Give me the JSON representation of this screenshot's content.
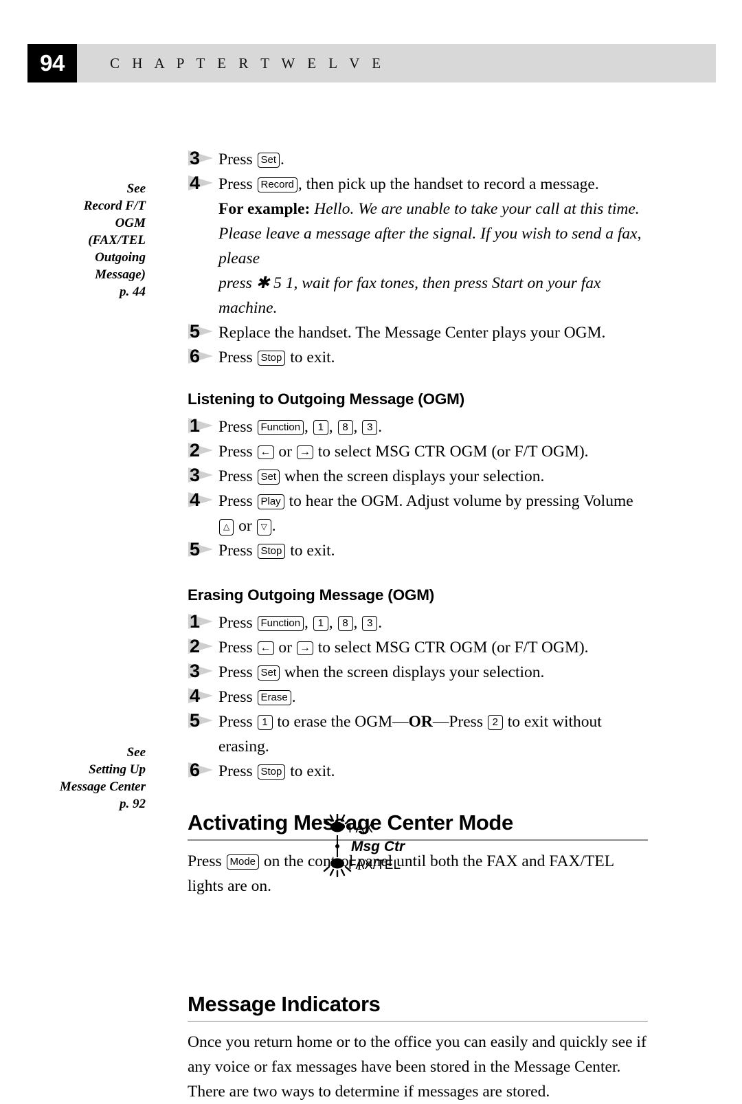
{
  "header": {
    "page_number": "94",
    "chapter_label": "C H A P T E R   T W E L V E"
  },
  "margin_notes": [
    {
      "name": "margin-note-record-ft-ogm",
      "lines": [
        "See",
        "Record F/T",
        "OGM",
        "(FAX/TEL",
        "Outgoing",
        "Message)",
        "p. 44"
      ]
    },
    {
      "name": "margin-note-setting-up-message-center",
      "lines": [
        "See",
        "Setting Up",
        "Message Center",
        "p. 92"
      ]
    }
  ],
  "steps_record": [
    {
      "num": "3",
      "parts": [
        {
          "t": "text",
          "v": "Press "
        },
        {
          "t": "key",
          "v": "Set"
        },
        {
          "t": "text",
          "v": "."
        }
      ]
    },
    {
      "num": "4",
      "parts": [
        {
          "t": "text",
          "v": "Press "
        },
        {
          "t": "key",
          "v": "Record"
        },
        {
          "t": "text",
          "v": ", then pick up the handset to record a message."
        }
      ]
    }
  ],
  "example": {
    "lead": "For example:",
    "lines": [
      " Hello. We are unable to take your call at this time.",
      "Please leave a message after the signal. If you wish to send a fax,",
      "please",
      "press ✱ 5 1, wait for fax tones, then press Start on your fax machine."
    ]
  },
  "steps_record_tail": [
    {
      "num": "5",
      "parts": [
        {
          "t": "text",
          "v": "Replace the handset. The Message Center plays your OGM."
        }
      ]
    },
    {
      "num": "6",
      "parts": [
        {
          "t": "text",
          "v": "Press "
        },
        {
          "t": "key",
          "v": "Stop"
        },
        {
          "t": "text",
          "v": " to exit."
        }
      ]
    }
  ],
  "section_listening": {
    "heading": "Listening to Outgoing Message (OGM)",
    "steps": [
      {
        "num": "1",
        "parts": [
          {
            "t": "text",
            "v": "Press "
          },
          {
            "t": "key",
            "v": "Function"
          },
          {
            "t": "text",
            "v": ", "
          },
          {
            "t": "numkey",
            "v": "1"
          },
          {
            "t": "text",
            "v": ", "
          },
          {
            "t": "numkey",
            "v": "8"
          },
          {
            "t": "text",
            "v": ", "
          },
          {
            "t": "numkey",
            "v": "3"
          },
          {
            "t": "text",
            "v": "."
          }
        ]
      },
      {
        "num": "2",
        "parts": [
          {
            "t": "text",
            "v": "Press "
          },
          {
            "t": "arrowkey",
            "v": "←"
          },
          {
            "t": "text",
            "v": " or "
          },
          {
            "t": "arrowkey",
            "v": "→"
          },
          {
            "t": "text",
            "v": " to select MSG CTR OGM (or F/T OGM)."
          }
        ]
      },
      {
        "num": "3",
        "parts": [
          {
            "t": "text",
            "v": "Press "
          },
          {
            "t": "key",
            "v": "Set"
          },
          {
            "t": "text",
            "v": " when the screen displays your selection."
          }
        ]
      },
      {
        "num": "4",
        "parts": [
          {
            "t": "text",
            "v": "Press "
          },
          {
            "t": "key",
            "v": "Play"
          },
          {
            "t": "text",
            "v": " to hear the OGM. Adjust volume by pressing Volume"
          },
          {
            "t": "br",
            "v": ""
          },
          {
            "t": "trikey",
            "v": "△"
          },
          {
            "t": "text",
            "v": " or "
          },
          {
            "t": "trikey",
            "v": "▽"
          },
          {
            "t": "text",
            "v": "."
          }
        ]
      },
      {
        "num": "5",
        "parts": [
          {
            "t": "text",
            "v": "Press "
          },
          {
            "t": "key",
            "v": "Stop"
          },
          {
            "t": "text",
            "v": " to exit."
          }
        ]
      }
    ]
  },
  "section_erasing": {
    "heading": "Erasing Outgoing Message (OGM)",
    "steps": [
      {
        "num": "1",
        "parts": [
          {
            "t": "text",
            "v": "Press "
          },
          {
            "t": "key",
            "v": "Function"
          },
          {
            "t": "text",
            "v": ", "
          },
          {
            "t": "numkey",
            "v": "1"
          },
          {
            "t": "text",
            "v": ", "
          },
          {
            "t": "numkey",
            "v": "8"
          },
          {
            "t": "text",
            "v": ", "
          },
          {
            "t": "numkey",
            "v": "3"
          },
          {
            "t": "text",
            "v": "."
          }
        ]
      },
      {
        "num": "2",
        "parts": [
          {
            "t": "text",
            "v": "Press "
          },
          {
            "t": "arrowkey",
            "v": "←"
          },
          {
            "t": "text",
            "v": " or "
          },
          {
            "t": "arrowkey",
            "v": "→"
          },
          {
            "t": "text",
            "v": " to select MSG CTR OGM (or F/T OGM)."
          }
        ]
      },
      {
        "num": "3",
        "parts": [
          {
            "t": "text",
            "v": "Press "
          },
          {
            "t": "key",
            "v": "Set"
          },
          {
            "t": "text",
            "v": " when the screen displays your selection."
          }
        ]
      },
      {
        "num": "4",
        "parts": [
          {
            "t": "text",
            "v": "Press "
          },
          {
            "t": "key",
            "v": "Erase"
          },
          {
            "t": "text",
            "v": "."
          }
        ]
      },
      {
        "num": "5",
        "parts": [
          {
            "t": "text",
            "v": "Press "
          },
          {
            "t": "numkey",
            "v": "1"
          },
          {
            "t": "text",
            "v": " to erase the OGM—"
          },
          {
            "t": "bold",
            "v": "OR"
          },
          {
            "t": "text",
            "v": "—Press "
          },
          {
            "t": "numkey",
            "v": "2"
          },
          {
            "t": "text",
            "v": " to exit without erasing."
          }
        ]
      },
      {
        "num": "6",
        "parts": [
          {
            "t": "text",
            "v": "Press "
          },
          {
            "t": "key",
            "v": "Stop"
          },
          {
            "t": "text",
            "v": " to exit."
          }
        ]
      }
    ]
  },
  "section_activating": {
    "heading": "Activating Message Center Mode",
    "paragraph_parts": [
      {
        "t": "text",
        "v": "Press "
      },
      {
        "t": "key",
        "v": "Mode"
      },
      {
        "t": "text",
        "v": " on the control panel until both the FAX and FAX/TEL lights are on."
      }
    ]
  },
  "led_diagram": {
    "fax_label": "FAX",
    "msg_ctr_label": "Msg Ctr",
    "fax_tel_label": "FAX/TEL"
  },
  "section_indicators": {
    "heading": "Message Indicators",
    "paragraph": "Once you return home or to the office you can easily and quickly see if any voice or fax messages have been stored in the Message Center. There are two ways to determine if messages are stored."
  }
}
